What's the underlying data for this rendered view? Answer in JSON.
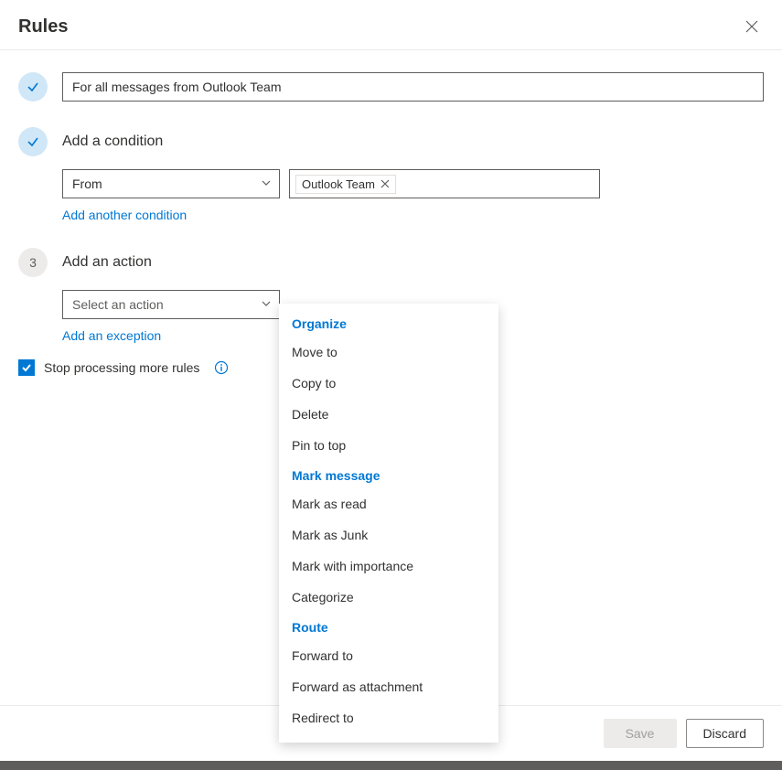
{
  "header": {
    "title": "Rules"
  },
  "rule_name": {
    "value": "For all messages from Outlook Team"
  },
  "condition": {
    "label": "Add a condition",
    "type_selected": "From",
    "people": [
      {
        "name": "Outlook Team"
      }
    ],
    "add_another": "Add another condition"
  },
  "action": {
    "step_number": "3",
    "label": "Add an action",
    "select_placeholder": "Select an action",
    "add_exception": "Add an exception",
    "menu": {
      "groups": [
        {
          "header": "Organize",
          "items": [
            "Move to",
            "Copy to",
            "Delete",
            "Pin to top"
          ]
        },
        {
          "header": "Mark message",
          "items": [
            "Mark as read",
            "Mark as Junk",
            "Mark with importance",
            "Categorize"
          ]
        },
        {
          "header": "Route",
          "items": [
            "Forward to",
            "Forward as attachment",
            "Redirect to"
          ]
        }
      ]
    }
  },
  "stop_processing": {
    "label": "Stop processing more rules",
    "checked": true
  },
  "footer": {
    "save": "Save",
    "discard": "Discard"
  }
}
